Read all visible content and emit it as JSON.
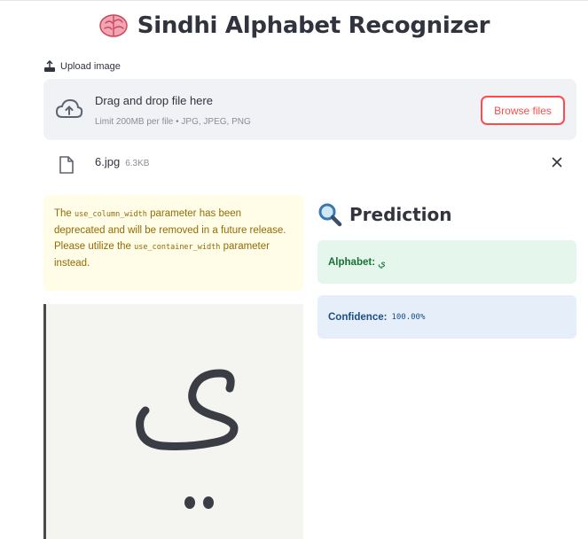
{
  "app": {
    "title": "Sindhi Alphabet Recognizer",
    "title_icon": "brain-icon"
  },
  "uploader": {
    "label": "Upload image",
    "drop_title": "Drag and drop file here",
    "drop_subtitle": "Limit 200MB per file • JPG, JPEG, PNG",
    "browse_label": "Browse files",
    "accent_color": "#ff4b4b"
  },
  "file": {
    "name": "6.jpg",
    "size": "6.3KB"
  },
  "warning": {
    "part1": "The ",
    "code1": "use_column_width",
    "part2": " parameter has been deprecated and will be removed in a future release. Please utilize the ",
    "code2": "use_container_width",
    "part3": " parameter instead.",
    "bg_color": "#fffce7"
  },
  "prediction": {
    "title": "Prediction",
    "title_icon": "magnifier-icon",
    "alphabet_label": "Alphabet:",
    "alphabet_value": "ي",
    "confidence_label": "Confidence:",
    "confidence_value": "100.00%"
  },
  "preview": {
    "glyph": "ي"
  }
}
